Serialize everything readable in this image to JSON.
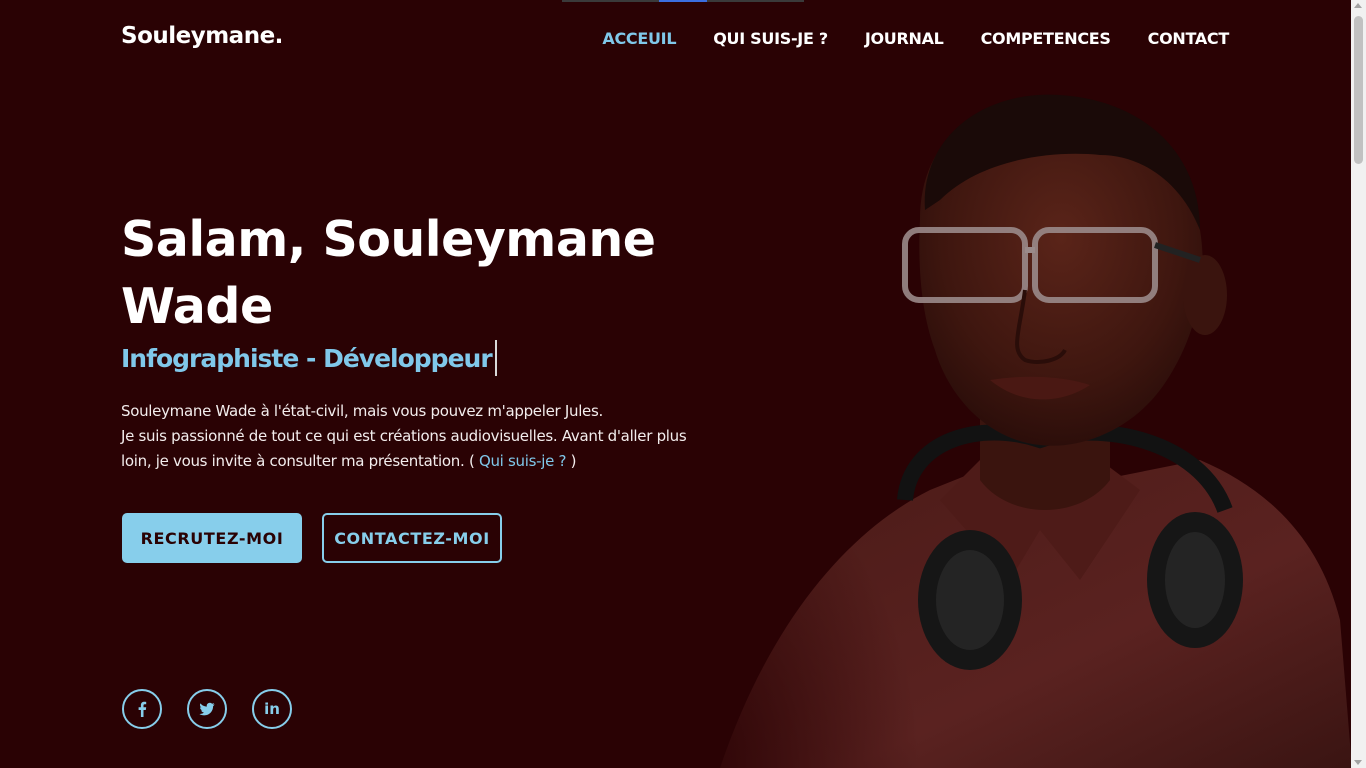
{
  "brand": "Souleymane.",
  "nav": {
    "items": [
      {
        "label": "ACCEUIL",
        "active": true
      },
      {
        "label": "QUI SUIS-JE ?",
        "active": false
      },
      {
        "label": "JOURNAL",
        "active": false
      },
      {
        "label": "COMPETENCES",
        "active": false
      },
      {
        "label": "CONTACT",
        "active": false
      }
    ]
  },
  "hero": {
    "title_line1": "Salam, Souleymane",
    "title_line2": "Wade",
    "subtitle": "Infographiste - Développeur",
    "desc_line1": "Souleymane Wade à l'état-civil, mais vous pouvez m'appeler Jules.",
    "desc_line2": "Je suis passionné de tout ce qui est créations audiovisuelles. Avant d'aller plus loin, je vous invite à consulter ma présentation. ( ",
    "desc_link": "Qui suis-je ?",
    "desc_end": " )"
  },
  "buttons": {
    "primary": "RECRUTEZ-MOI",
    "secondary": "CONTACTEZ-MOI"
  },
  "social": {
    "icons": [
      "facebook-icon",
      "twitter-icon",
      "linkedin-icon"
    ],
    "linkedin_text": "in"
  },
  "colors": {
    "background": "#2a0204",
    "accent": "#87ceeb",
    "text": "#ffffff"
  }
}
